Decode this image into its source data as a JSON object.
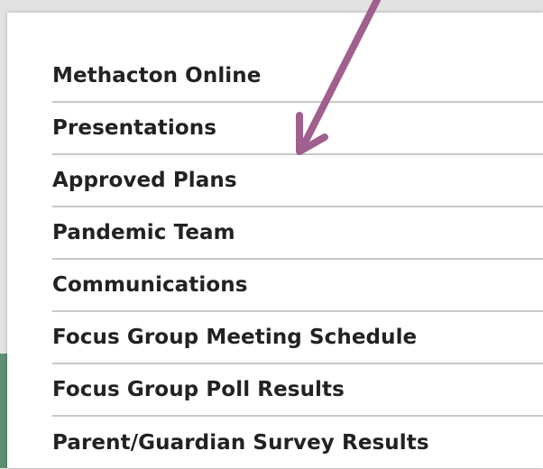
{
  "menu": {
    "items": [
      {
        "label": "Methacton Online"
      },
      {
        "label": "Presentations"
      },
      {
        "label": "Approved Plans"
      },
      {
        "label": "Pandemic Team"
      },
      {
        "label": "Communications"
      },
      {
        "label": "Focus Group Meeting Schedule"
      },
      {
        "label": "Focus Group Poll Results"
      },
      {
        "label": "Parent/Guardian Survey Results"
      }
    ]
  },
  "annotation": {
    "arrow_color": "#a0608f"
  },
  "colors": {
    "background_gray": "#e2e2e2",
    "background_green": "#5f8f73",
    "panel": "#ffffff",
    "text": "#222222",
    "divider": "#c8c8c8"
  }
}
